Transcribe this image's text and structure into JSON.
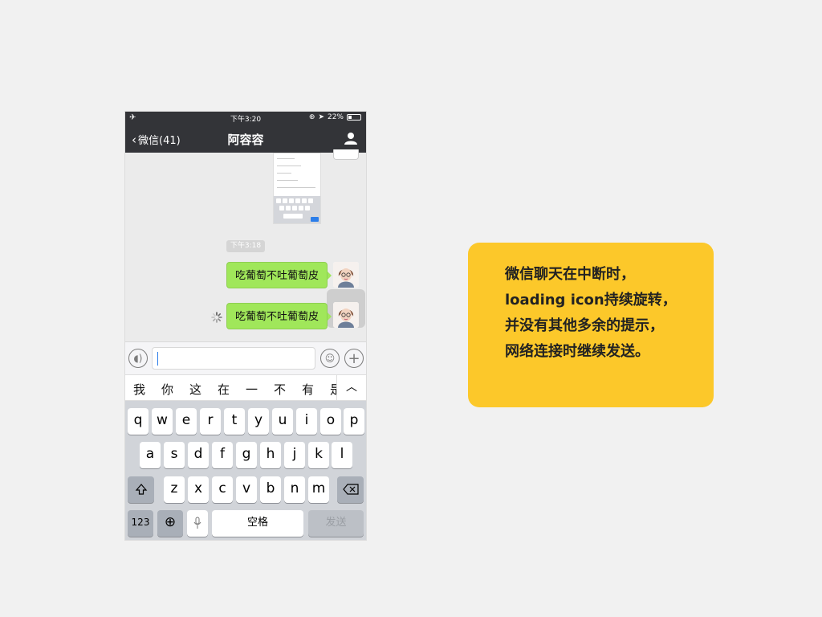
{
  "status_bar": {
    "time": "下午3:20",
    "battery": "22%"
  },
  "nav": {
    "back_label": "微信(41)",
    "title": "阿容容"
  },
  "chat": {
    "timestamp": "下午3:18",
    "messages": [
      {
        "text": "吃葡萄不吐葡萄皮",
        "status": "sent"
      },
      {
        "text": "吃葡萄不吐葡萄皮",
        "status": "sending"
      }
    ]
  },
  "candidates": [
    "我",
    "你",
    "这",
    "在",
    "一",
    "不",
    "有",
    "是"
  ],
  "keyboard": {
    "row1": [
      "q",
      "w",
      "e",
      "r",
      "t",
      "y",
      "u",
      "i",
      "o",
      "p"
    ],
    "row2": [
      "a",
      "s",
      "d",
      "f",
      "g",
      "h",
      "j",
      "k",
      "l"
    ],
    "row3": [
      "z",
      "x",
      "c",
      "v",
      "b",
      "n",
      "m"
    ],
    "numbers_label": "123",
    "space_label": "空格",
    "send_label": "发送"
  },
  "annotation": {
    "text": "微信聊天在中断时，loading icon持续旋转，并没有其他多余的提示，网络连接时继续发送。"
  },
  "colors": {
    "nav_bg": "#333438",
    "bubble_green": "#a0e75a",
    "note_yellow": "#fcc82a",
    "page_bg": "#f1f1f1"
  },
  "icons": [
    "airplane-icon",
    "back-chevron-icon",
    "contact-person-icon",
    "voice-icon",
    "emoji-icon",
    "plus-icon",
    "loading-spinner-icon",
    "shift-icon",
    "backspace-icon",
    "globe-icon",
    "microphone-icon",
    "chevron-up-icon"
  ]
}
